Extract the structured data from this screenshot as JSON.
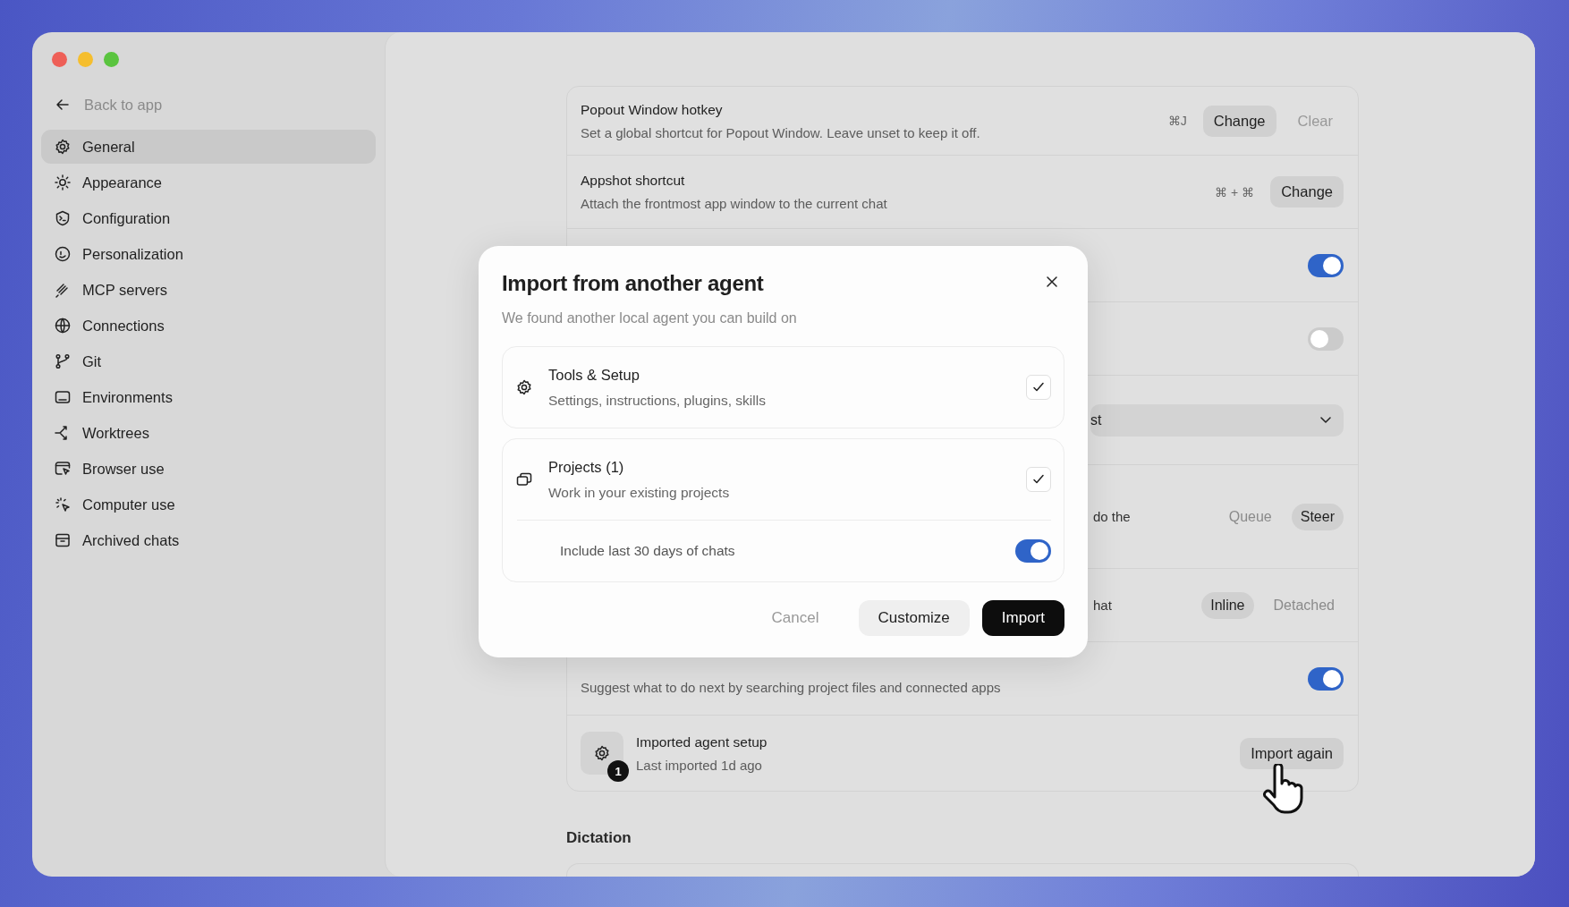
{
  "sidebar": {
    "back_link": "Back to app",
    "items": [
      {
        "label": "General",
        "selected": true
      },
      {
        "label": "Appearance",
        "selected": false
      },
      {
        "label": "Configuration",
        "selected": false
      },
      {
        "label": "Personalization",
        "selected": false
      },
      {
        "label": "MCP servers",
        "selected": false
      },
      {
        "label": "Connections",
        "selected": false
      },
      {
        "label": "Git",
        "selected": false
      },
      {
        "label": "Environments",
        "selected": false
      },
      {
        "label": "Worktrees",
        "selected": false
      },
      {
        "label": "Browser use",
        "selected": false
      },
      {
        "label": "Computer use",
        "selected": false
      },
      {
        "label": "Archived chats",
        "selected": false
      }
    ]
  },
  "settings": {
    "rows": [
      {
        "kind": "hotkey",
        "title": "Popout Window hotkey",
        "description": "Set a global shortcut for Popout Window. Leave unset to keep it off.",
        "keys": "⌘J",
        "buttons": [
          {
            "label": "Change",
            "filled": true
          },
          {
            "label": "Clear",
            "filled": false
          }
        ]
      },
      {
        "kind": "hotkey",
        "title": "Appshot shortcut",
        "description": "Attach the frontmost app window to the current chat",
        "keys": "⌘ + ⌘",
        "buttons": [
          {
            "label": "Change",
            "filled": true
          }
        ]
      },
      {
        "kind": "toggle",
        "on": true
      },
      {
        "kind": "toggle",
        "on": false
      },
      {
        "kind": "select",
        "value": "st"
      },
      {
        "kind": "segmented",
        "description": "do the",
        "options": [
          {
            "label": "Queue",
            "selected": false
          },
          {
            "label": "Steer",
            "selected": true
          }
        ]
      },
      {
        "kind": "segmented",
        "description": "hat",
        "options": [
          {
            "label": "Inline",
            "selected": true
          },
          {
            "label": "Detached",
            "selected": false
          }
        ]
      },
      {
        "kind": "toggle",
        "description": "Suggest what to do next by searching project files and connected apps",
        "on": true
      },
      {
        "kind": "imported",
        "title": "Imported agent setup",
        "description": "Last imported 1d ago",
        "badge": "1",
        "buttons": [
          {
            "label": "Import again",
            "filled": true
          }
        ]
      }
    ],
    "section": "Dictation"
  },
  "dialog": {
    "title": "Import from another agent",
    "subtitle": "We found another local agent you can build on",
    "options": [
      {
        "title": "Tools & Setup",
        "description": "Settings, instructions, plugins, skills",
        "checked": true
      },
      {
        "title": "Projects (1)",
        "description": "Work in your existing projects",
        "checked": true,
        "sub_toggle": {
          "label": "Include last 30 days of chats",
          "on": true
        }
      }
    ],
    "buttons": [
      {
        "label": "Cancel",
        "kind": "text"
      },
      {
        "label": "Customize",
        "kind": "secondary"
      },
      {
        "label": "Import",
        "kind": "primary"
      }
    ]
  }
}
